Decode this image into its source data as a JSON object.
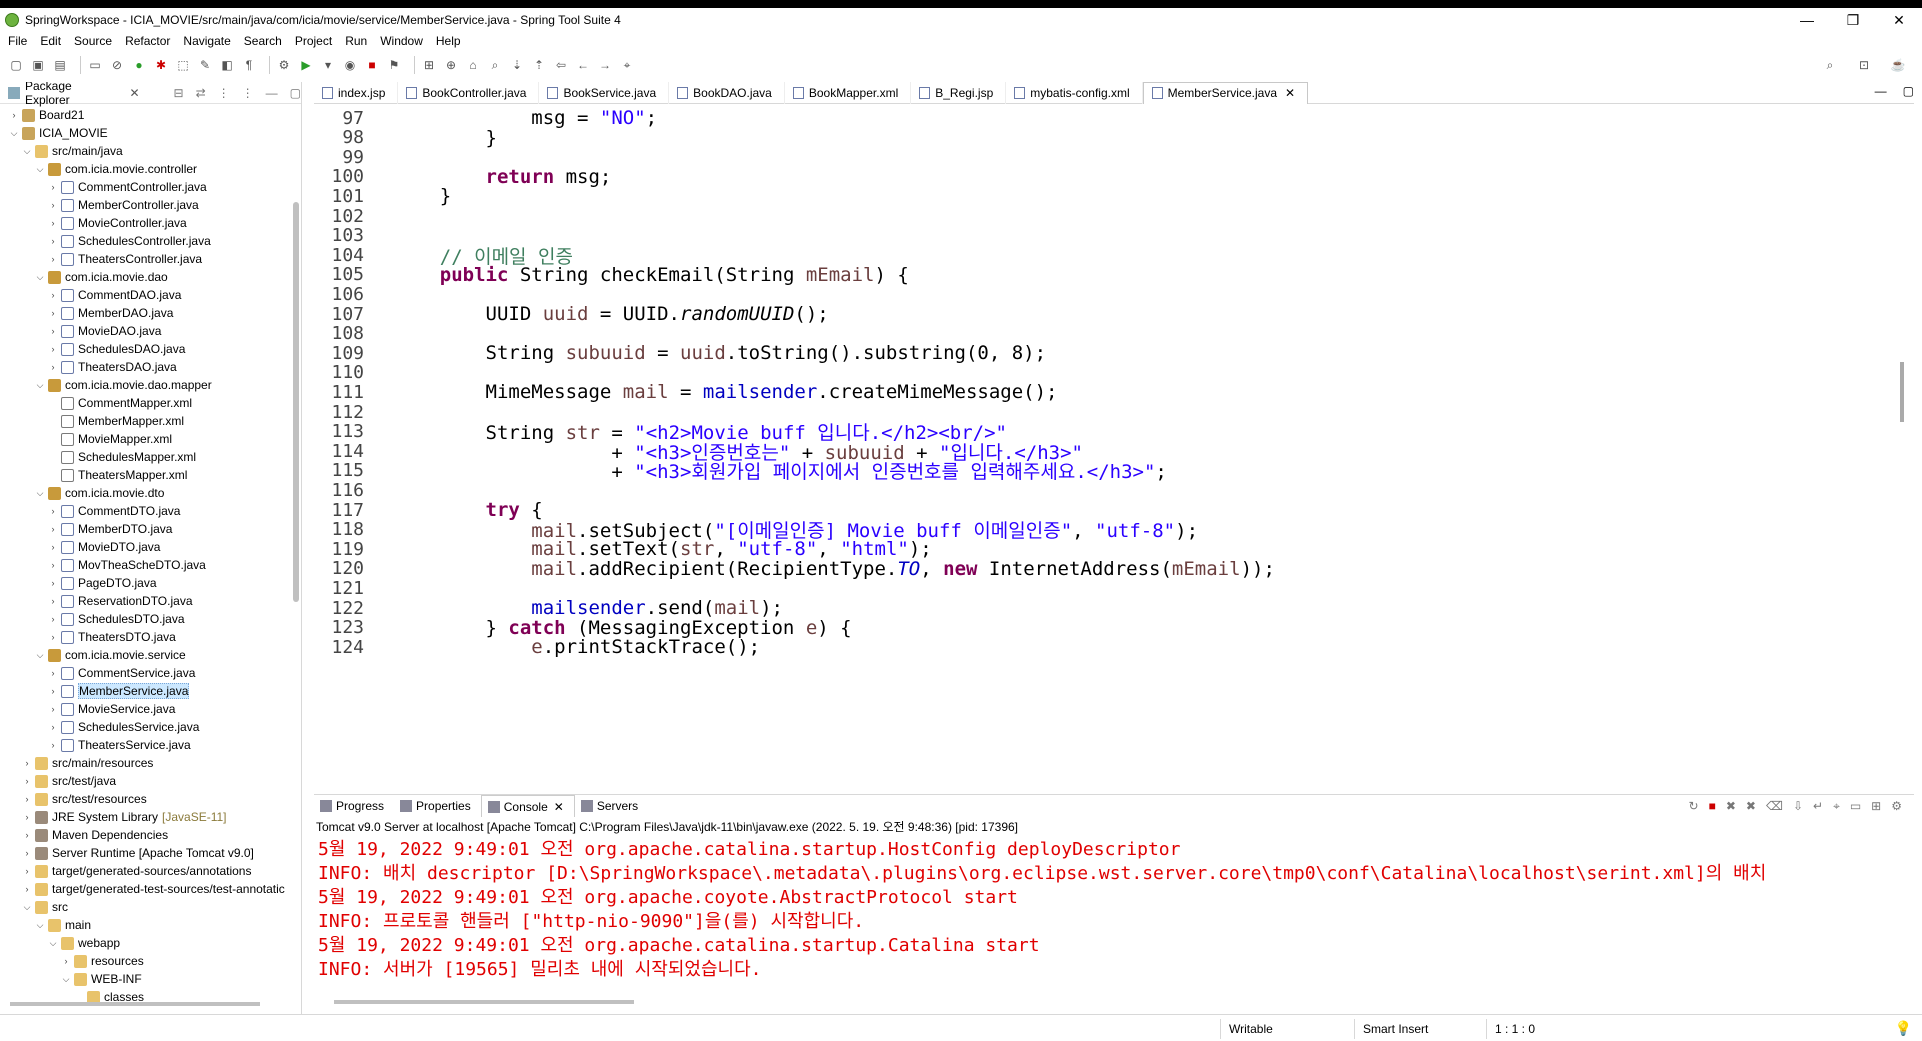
{
  "window": {
    "title": "SpringWorkspace - ICIA_MOVIE/src/main/java/com/icia/movie/service/MemberService.java - Spring Tool Suite 4",
    "controls": [
      "—",
      "❐",
      "✕"
    ]
  },
  "menu": [
    "File",
    "Edit",
    "Source",
    "Refactor",
    "Navigate",
    "Search",
    "Project",
    "Run",
    "Window",
    "Help"
  ],
  "explorer": {
    "title": "Package Explorer",
    "items": [
      {
        "label": "Board21",
        "arrow": ">",
        "icon": "proj"
      },
      {
        "label": "ICIA_MOVIE",
        "arrow": "v",
        "icon": "proj"
      },
      {
        "label": "src/main/java",
        "arrow": "v",
        "icon": "folder"
      },
      {
        "label": "com.icia.movie.controller",
        "arrow": "v",
        "icon": "pkgi"
      },
      {
        "label": "CommentController.java",
        "arrow": ">",
        "icon": "java"
      },
      {
        "label": "MemberController.java",
        "arrow": ">",
        "icon": "java"
      },
      {
        "label": "MovieController.java",
        "arrow": ">",
        "icon": "java"
      },
      {
        "label": "SchedulesController.java",
        "arrow": ">",
        "icon": "java"
      },
      {
        "label": "TheatersController.java",
        "arrow": ">",
        "icon": "java"
      },
      {
        "label": "com.icia.movie.dao",
        "arrow": "v",
        "icon": "pkgi"
      },
      {
        "label": "CommentDAO.java",
        "arrow": ">",
        "icon": "java"
      },
      {
        "label": "MemberDAO.java",
        "arrow": ">",
        "icon": "java"
      },
      {
        "label": "MovieDAO.java",
        "arrow": ">",
        "icon": "java"
      },
      {
        "label": "SchedulesDAO.java",
        "arrow": ">",
        "icon": "java"
      },
      {
        "label": "TheatersDAO.java",
        "arrow": ">",
        "icon": "java"
      },
      {
        "label": "com.icia.movie.dao.mapper",
        "arrow": "v",
        "icon": "pkgi"
      },
      {
        "label": "CommentMapper.xml",
        "arrow": "",
        "icon": "xml"
      },
      {
        "label": "MemberMapper.xml",
        "arrow": "",
        "icon": "xml"
      },
      {
        "label": "MovieMapper.xml",
        "arrow": "",
        "icon": "xml"
      },
      {
        "label": "SchedulesMapper.xml",
        "arrow": "",
        "icon": "xml"
      },
      {
        "label": "TheatersMapper.xml",
        "arrow": "",
        "icon": "xml"
      },
      {
        "label": "com.icia.movie.dto",
        "arrow": "v",
        "icon": "pkgi"
      },
      {
        "label": "CommentDTO.java",
        "arrow": ">",
        "icon": "java"
      },
      {
        "label": "MemberDTO.java",
        "arrow": ">",
        "icon": "java"
      },
      {
        "label": "MovieDTO.java",
        "arrow": ">",
        "icon": "java"
      },
      {
        "label": "MovTheaScheDTO.java",
        "arrow": ">",
        "icon": "java"
      },
      {
        "label": "PageDTO.java",
        "arrow": ">",
        "icon": "java"
      },
      {
        "label": "ReservationDTO.java",
        "arrow": ">",
        "icon": "java"
      },
      {
        "label": "SchedulesDTO.java",
        "arrow": ">",
        "icon": "java"
      },
      {
        "label": "TheatersDTO.java",
        "arrow": ">",
        "icon": "java"
      },
      {
        "label": "com.icia.movie.service",
        "arrow": "v",
        "icon": "pkgi"
      },
      {
        "label": "CommentService.java",
        "arrow": ">",
        "icon": "java"
      },
      {
        "label": "MemberService.java",
        "arrow": ">",
        "icon": "java",
        "selected": true
      },
      {
        "label": "MovieService.java",
        "arrow": ">",
        "icon": "java"
      },
      {
        "label": "SchedulesService.java",
        "arrow": ">",
        "icon": "java"
      },
      {
        "label": "TheatersService.java",
        "arrow": ">",
        "icon": "java"
      },
      {
        "label": "src/main/resources",
        "arrow": ">",
        "icon": "folder"
      },
      {
        "label": "src/test/java",
        "arrow": ">",
        "icon": "folder"
      },
      {
        "label": "src/test/resources",
        "arrow": ">",
        "icon": "folder"
      },
      {
        "label": "JRE System Library",
        "ext": "[JavaSE-11]",
        "arrow": ">",
        "icon": "lib"
      },
      {
        "label": "Maven Dependencies",
        "arrow": ">",
        "icon": "lib"
      },
      {
        "label": "Server Runtime [Apache Tomcat v9.0]",
        "arrow": ">",
        "icon": "lib"
      },
      {
        "label": "target/generated-sources/annotations",
        "arrow": ">",
        "icon": "folder"
      },
      {
        "label": "target/generated-test-sources/test-annotatic",
        "arrow": ">",
        "icon": "folder"
      },
      {
        "label": "src",
        "arrow": "v",
        "icon": "folder"
      },
      {
        "label": "main",
        "arrow": "v",
        "icon": "folder"
      },
      {
        "label": "webapp",
        "arrow": "v",
        "icon": "folder"
      },
      {
        "label": "resources",
        "arrow": ">",
        "icon": "folder"
      },
      {
        "label": "WEB-INF",
        "arrow": "v",
        "icon": "folder"
      },
      {
        "label": "classes",
        "arrow": "",
        "icon": "folder"
      }
    ]
  },
  "editor": {
    "tabs": [
      {
        "label": "index.jsp"
      },
      {
        "label": "BookController.java"
      },
      {
        "label": "BookService.java"
      },
      {
        "label": "BookDAO.java"
      },
      {
        "label": "BookMapper.xml"
      },
      {
        "label": "B_Regi.jsp"
      },
      {
        "label": "mybatis-config.xml"
      },
      {
        "label": "MemberService.java",
        "active": true
      }
    ],
    "lines": [
      {
        "n": "97",
        "html": "            msg = <span class=\"str\">\"NO\"</span>;"
      },
      {
        "n": "98",
        "html": "        }"
      },
      {
        "n": "99",
        "html": ""
      },
      {
        "n": "100",
        "html": "        <span class=\"kw\">return</span> msg;"
      },
      {
        "n": "101",
        "html": "    }"
      },
      {
        "n": "102",
        "html": ""
      },
      {
        "n": "103",
        "html": ""
      },
      {
        "n": "104",
        "html": "    <span class=\"cm\">// 이메일 인증</span>"
      },
      {
        "n": "105",
        "html": "    <span class=\"kw\">public</span> String checkEmail(String <span class=\"var\">mEmail</span>) {"
      },
      {
        "n": "106",
        "html": ""
      },
      {
        "n": "107",
        "html": "        UUID <span class=\"var\">uuid</span> = UUID.<span class=\"ital\">randomUUID</span>();"
      },
      {
        "n": "108",
        "html": ""
      },
      {
        "n": "109",
        "html": "        String <span class=\"var\">subuuid</span> = <span class=\"var\">uuid</span>.toString().substring(0, 8);"
      },
      {
        "n": "110",
        "html": ""
      },
      {
        "n": "111",
        "html": "        MimeMessage <span class=\"var\">mail</span> = <span class=\"fld\">mailsender</span>.createMimeMessage();"
      },
      {
        "n": "112",
        "html": ""
      },
      {
        "n": "113",
        "html": "        String <span class=\"var\">str</span> = <span class=\"str\">\"&lt;h2&gt;Movie buff 입니다.&lt;/h2&gt;&lt;br/&gt;\"</span>"
      },
      {
        "n": "114",
        "html": "                   + <span class=\"str\">\"&lt;h3&gt;인증번호는\"</span> + <span class=\"var\">subuuid</span> + <span class=\"str\">\"입니다.&lt;/h3&gt;\"</span>"
      },
      {
        "n": "115",
        "html": "                   + <span class=\"str\">\"&lt;h3&gt;회원가입 페이지에서 인증번호를 입력해주세요.&lt;/h3&gt;\"</span>;"
      },
      {
        "n": "116",
        "html": ""
      },
      {
        "n": "117",
        "html": "        <span class=\"kw\">try</span> {"
      },
      {
        "n": "118",
        "html": "            <span class=\"var\">mail</span>.setSubject(<span class=\"str\">\"[이메일인증] Movie buff 이메일인증\"</span>, <span class=\"str\">\"utf-8\"</span>);"
      },
      {
        "n": "119",
        "html": "            <span class=\"var\">mail</span>.setText(<span class=\"var\">str</span>, <span class=\"str\">\"utf-8\"</span>, <span class=\"str\">\"html\"</span>);"
      },
      {
        "n": "120",
        "html": "            <span class=\"var\">mail</span>.addRecipient(RecipientType.<span class=\"fld ital\">TO</span>, <span class=\"kw\">new</span> InternetAddress(<span class=\"var\">mEmail</span>));"
      },
      {
        "n": "121",
        "html": ""
      },
      {
        "n": "122",
        "html": "            <span class=\"fld\">mailsender</span>.send(<span class=\"var\">mail</span>);"
      },
      {
        "n": "123",
        "html": "        } <span class=\"kw\">catch</span> (MessagingException <span class=\"var\">e</span>) {"
      },
      {
        "n": "124",
        "html": "            <span class=\"var\">e</span>.printStackTrace();"
      }
    ]
  },
  "console": {
    "tabs": [
      {
        "label": "Progress"
      },
      {
        "label": "Properties"
      },
      {
        "label": "Console",
        "active": true
      },
      {
        "label": "Servers"
      }
    ],
    "header": "Tomcat v9.0 Server at localhost [Apache Tomcat] C:\\Program Files\\Java\\jdk-11\\bin\\javaw.exe  (2022. 5. 19. 오전 9:48:36) [pid: 17396]",
    "lines": [
      "5월 19, 2022 9:49:01 오전 org.apache.catalina.startup.HostConfig deployDescriptor",
      "INFO: 배치 descriptor [D:\\SpringWorkspace\\.metadata\\.plugins\\org.eclipse.wst.server.core\\tmp0\\conf\\Catalina\\localhost\\serint.xml]의 배치",
      "5월 19, 2022 9:49:01 오전 org.apache.coyote.AbstractProtocol start",
      "INFO: 프로토콜 핸들러 [\"http-nio-9090\"]을(를) 시작합니다.",
      "5월 19, 2022 9:49:01 오전 org.apache.catalina.startup.Catalina start",
      "INFO: 서버가 [19565] 밀리초 내에 시작되었습니다."
    ]
  },
  "status": {
    "writable": "Writable",
    "insert_mode": "Smart Insert",
    "position": "1 : 1 : 0"
  }
}
